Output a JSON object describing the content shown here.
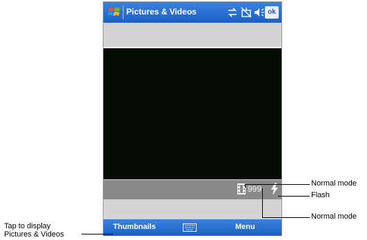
{
  "titlebar": {
    "title": "Pictures & Videos",
    "ok_label": "ok",
    "icons": [
      "windows-start-icon",
      "connectivity-icon",
      "no-network-icon",
      "volume-icon"
    ]
  },
  "camera": {
    "remaining_count": "999",
    "icons": [
      "film-icon",
      "flash-icon"
    ]
  },
  "menubar": {
    "left_softkey": "Thumbnails",
    "right_softkey": "Menu",
    "icons": [
      "keyboard-icon"
    ]
  },
  "annotations": {
    "normal_mode_top": "Normal mode",
    "flash": "Flash",
    "normal_mode_bottom": "Normal mode",
    "tap_line1": "Tap to display",
    "tap_line2": "Pictures & Videos"
  },
  "colors": {
    "titlebar_blue": "#1d5fc4",
    "viewfinder_black": "#050d05",
    "status_gray": "#8a8a8a"
  }
}
